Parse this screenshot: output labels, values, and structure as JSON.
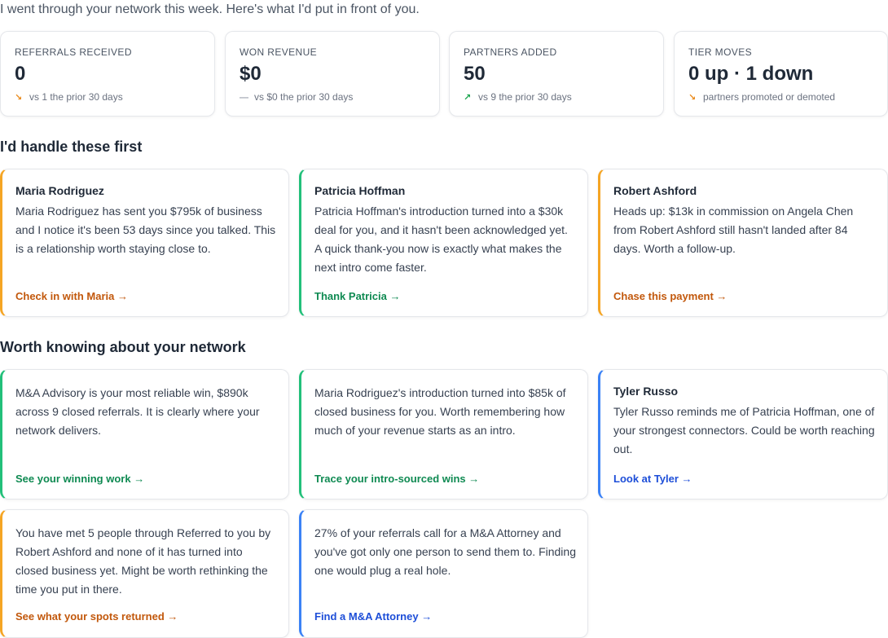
{
  "intro": "I went through your network this week. Here's what I'd put in front of you.",
  "stats": [
    {
      "label": "REFERRALS RECEIVED",
      "value": "0",
      "trend": "down",
      "trend_icon": "↘",
      "sub": "vs 1 the prior 30 days"
    },
    {
      "label": "WON REVENUE",
      "value": "$0",
      "trend": "flat",
      "trend_icon": "—",
      "sub": "vs $0 the prior 30 days"
    },
    {
      "label": "PARTNERS ADDED",
      "value": "50",
      "trend": "up",
      "trend_icon": "↗",
      "sub": "vs 9 the prior 30 days"
    },
    {
      "label": "TIER MOVES",
      "value": "0 up · 1 down",
      "trend": "down",
      "trend_icon": "↘",
      "sub": "partners promoted or demoted"
    }
  ],
  "sections": {
    "first": "I'd handle these first",
    "network": "Worth knowing about your network"
  },
  "cards": [
    {
      "accent": "orange",
      "name": "Maria Rodriguez",
      "body": "Maria Rodriguez has sent you $795k of business and I notice it's been 53 days since you talked. This is a relationship worth staying close to.",
      "link": "Check in with Maria →"
    },
    {
      "accent": "green",
      "name": "Patricia Hoffman",
      "body": "Patricia Hoffman's introduction turned into a $30k deal for you, and it hasn't been acknowledged yet. A quick thank-you now is exactly what makes the next intro come faster.",
      "link": "Thank Patricia →"
    },
    {
      "accent": "orange",
      "name": "Robert Ashford",
      "body": "Heads up: $13k in commission on Angela Chen from Robert Ashford still hasn't landed after 84 days. Worth a follow-up.",
      "link": "Chase this payment →"
    },
    {
      "accent": "green",
      "name": "",
      "body": "M&A Advisory is your most reliable win, $890k across 9 closed referrals. It is clearly where your network delivers.",
      "link": "See your winning work →"
    },
    {
      "accent": "green",
      "name": "",
      "body": "Maria Rodriguez's introduction turned into $85k of closed business for you. Worth remembering how much of your revenue starts as an intro.",
      "link": "Trace your intro-sourced wins →"
    },
    {
      "accent": "blue",
      "name": "Tyler Russo",
      "body": "Tyler Russo reminds me of Patricia Hoffman, one of your strongest connectors. Could be worth reaching out.",
      "link": "Look at Tyler →"
    },
    {
      "accent": "orange",
      "name": "",
      "body": "You have met 5 people through Referred to you by Robert Ashford and none of it has turned into closed business yet. Might be worth rethinking the time you put in there.",
      "link": "See what your spots returned →"
    },
    {
      "accent": "blue",
      "name": "",
      "body": "27% of your referrals call for a M&A Attorney and you've got only one person to send them to. Finding one would plug a real hole.",
      "link": "Find a M&A Attorney →"
    }
  ]
}
